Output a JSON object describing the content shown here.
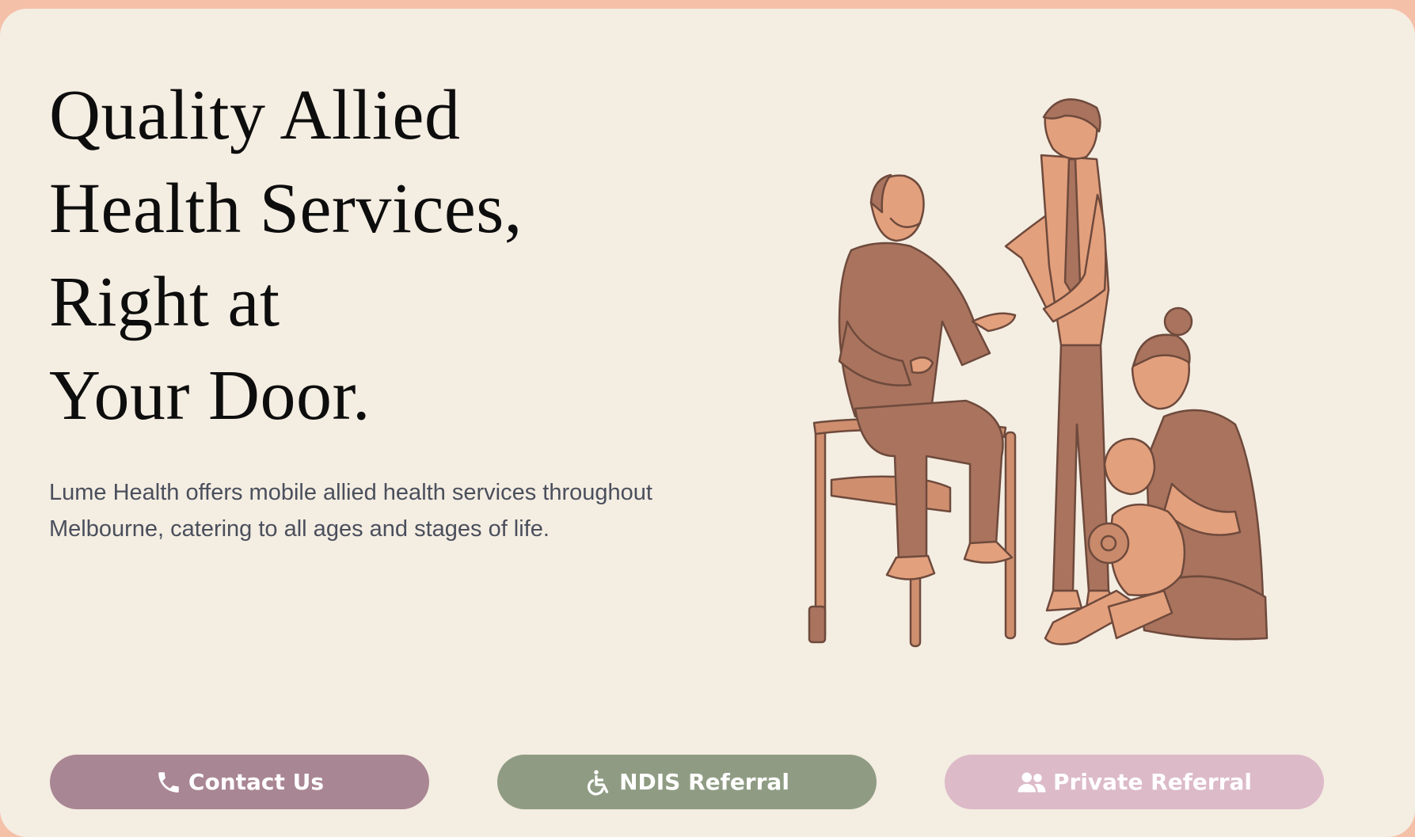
{
  "hero": {
    "title_lines": [
      "Quality Allied",
      "Health Services,",
      "Right at",
      "Your Door."
    ],
    "description": "Lume Health offers mobile allied health services throughout Melbourne, catering to all ages and stages of life."
  },
  "illustration": {
    "subject": "caregiver-with-elderly-man-and-mother-with-baby"
  },
  "actions": [
    {
      "label": "Contact Us",
      "icon": "phone-icon",
      "color": "#a98693"
    },
    {
      "label": "NDIS Referral",
      "icon": "wheelchair-icon",
      "color": "#8f9c83"
    },
    {
      "label": "Private Referral",
      "icon": "users-icon",
      "color": "#dcbac8"
    }
  ],
  "colors": {
    "page_border": "#f5c0a8",
    "card_background": "#f4ede2",
    "illustration_fill": "#a9735e",
    "illustration_skin": "#e3a07d",
    "illustration_line": "#6e4a3c"
  }
}
